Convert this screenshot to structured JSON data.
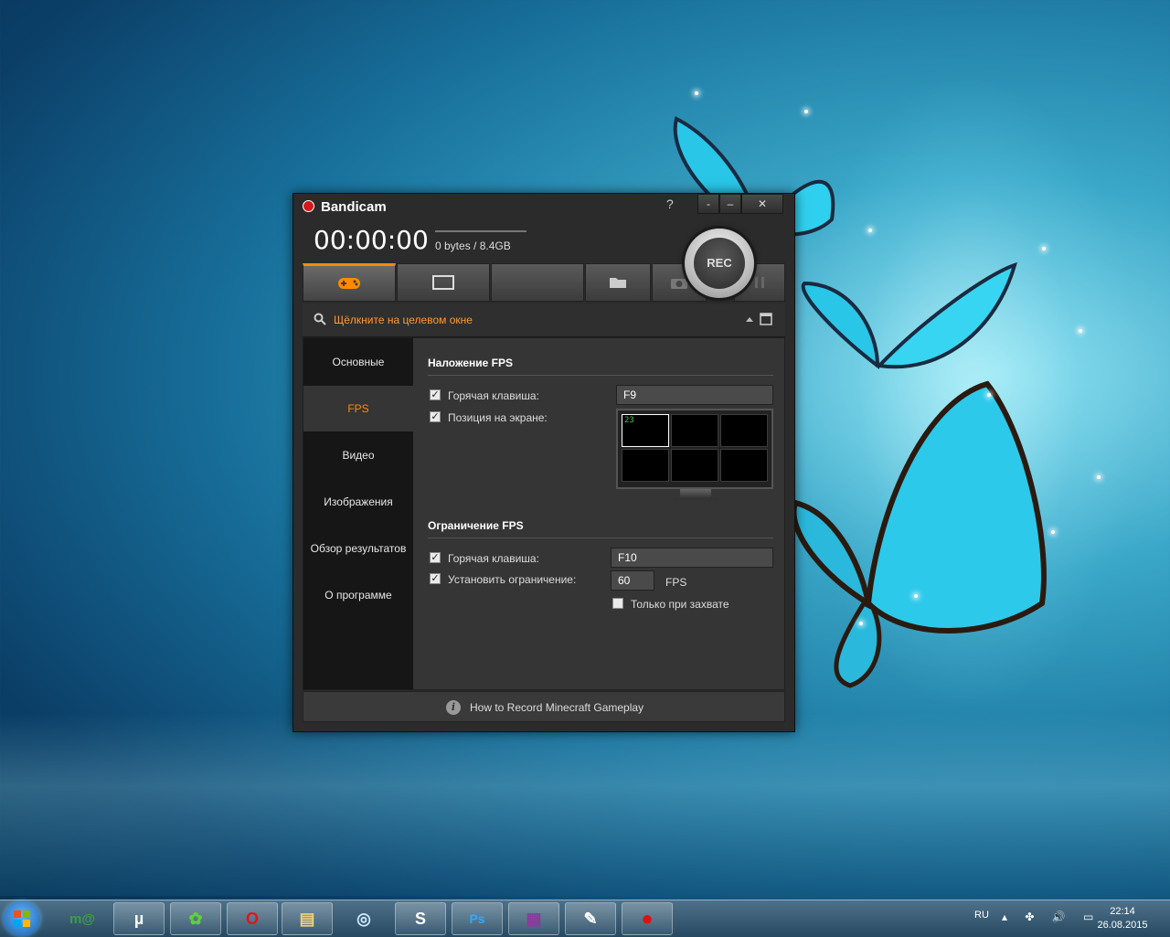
{
  "window": {
    "title": "Bandicam",
    "help_label": "?",
    "minimize_tray_label": "-",
    "minimize_label": "–",
    "close_label": "✕",
    "timer": "00:00:00",
    "file_size": "0 bytes / 8.4GB",
    "rec_label": "REC"
  },
  "mode_tabs": {
    "game_icon": "gamepad-icon",
    "screen_icon": "monitor-rect-icon",
    "folder_icon": "folder-icon",
    "camera_icon": "camera-icon",
    "pause_icon": "pause-icon"
  },
  "target": {
    "label": "Щёлкните на целевом окне",
    "color": "#ff9a2e"
  },
  "sidebar": {
    "items": [
      {
        "label": "Основные"
      },
      {
        "label": "FPS"
      },
      {
        "label": "Видео"
      },
      {
        "label": "Изображения"
      },
      {
        "label": "Обзор результатов"
      },
      {
        "label": "О программе"
      }
    ],
    "active_index": 1,
    "active_color": "#ff8a00"
  },
  "fps_overlay": {
    "title": "Наложение FPS",
    "hotkey_label": "Горячая клавиша:",
    "hotkey_value": "F9",
    "hotkey_checked": true,
    "position_label": "Позиция на экране:",
    "position_checked": true,
    "preview_fps": "23"
  },
  "fps_limit": {
    "title": "Ограничение FPS",
    "hotkey_label": "Горячая клавиша:",
    "hotkey_value": "F10",
    "hotkey_checked": true,
    "limit_label": "Установить ограничение:",
    "limit_checked": true,
    "limit_value": "60",
    "limit_unit": "FPS",
    "capture_only_label": "Только при захвате",
    "capture_only_checked": false
  },
  "footer": {
    "info_glyph": "i",
    "link_text": "How to Record Minecraft Gameplay"
  },
  "taskbar": {
    "apps": [
      {
        "icon": "mail-ru-agent-icon",
        "glyph": "m@"
      },
      {
        "icon": "utorrent-icon",
        "glyph": "µ"
      },
      {
        "icon": "icq-icon",
        "glyph": "✿"
      },
      {
        "icon": "opera-icon",
        "glyph": "O"
      },
      {
        "icon": "explorer-folder-icon",
        "glyph": "▤"
      },
      {
        "icon": "rocket-app-icon",
        "glyph": "◎"
      },
      {
        "icon": "skype-icon",
        "glyph": "S"
      },
      {
        "icon": "photoshop-icon",
        "glyph": "Ps"
      },
      {
        "icon": "winrar-icon",
        "glyph": "▦"
      },
      {
        "icon": "notepad-icon",
        "glyph": "✎"
      },
      {
        "icon": "bandicam-taskbar-icon",
        "glyph": "●"
      }
    ],
    "language": "RU",
    "tray_glyphs": "▴ ✤ 🔊 ▭",
    "time": "22:14",
    "date": "26.08.2015"
  }
}
